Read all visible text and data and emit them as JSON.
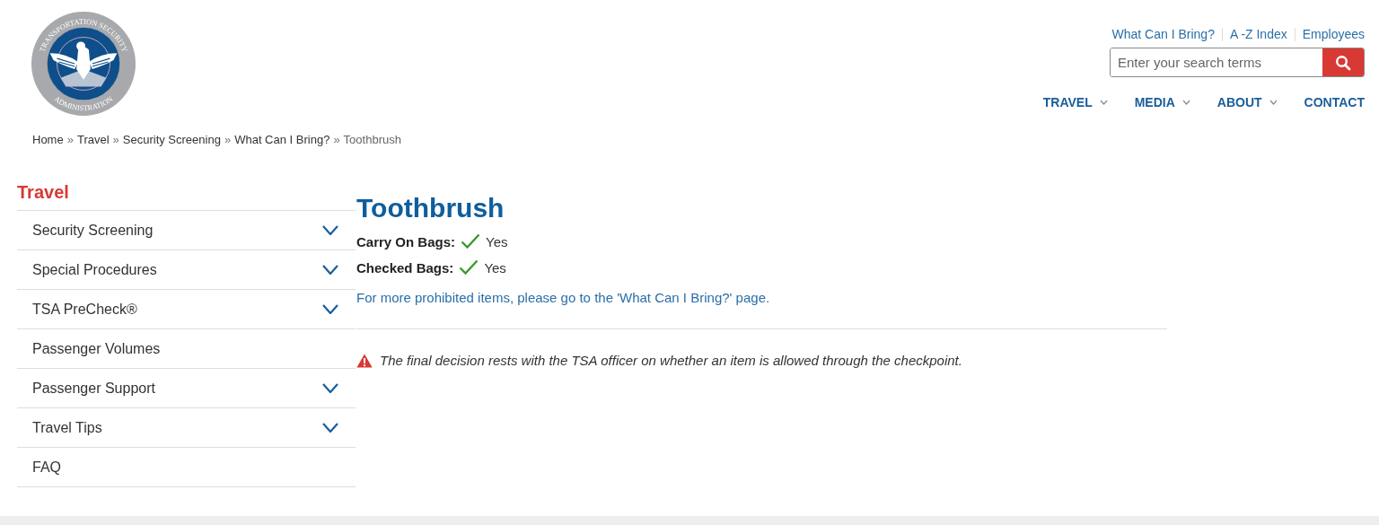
{
  "logo": {
    "top_text": "TRANSPORTATION SECURITY",
    "bottom_text": "ADMINISTRATION"
  },
  "utility_links": [
    "What Can I Bring?",
    "A -Z Index",
    "Employees"
  ],
  "search": {
    "placeholder": "Enter your search terms"
  },
  "nav": [
    {
      "label": "TRAVEL",
      "dropdown": true
    },
    {
      "label": "MEDIA",
      "dropdown": true
    },
    {
      "label": "ABOUT",
      "dropdown": true
    },
    {
      "label": "CONTACT",
      "dropdown": false
    }
  ],
  "breadcrumb_separator": "»",
  "breadcrumb": [
    {
      "label": "Home",
      "current": false
    },
    {
      "label": "Travel",
      "current": false
    },
    {
      "label": "Security Screening",
      "current": false
    },
    {
      "label": "What Can I Bring?",
      "current": false
    },
    {
      "label": "Toothbrush",
      "current": true
    }
  ],
  "sidebar": {
    "title": "Travel",
    "items": [
      {
        "label": "Security Screening",
        "expandable": true
      },
      {
        "label": "Special Procedures",
        "expandable": true
      },
      {
        "label": "TSA PreCheck®",
        "expandable": true
      },
      {
        "label": "Passenger Volumes",
        "expandable": false
      },
      {
        "label": "Passenger Support",
        "expandable": true
      },
      {
        "label": "Travel Tips",
        "expandable": true
      },
      {
        "label": "FAQ",
        "expandable": false
      }
    ]
  },
  "item": {
    "title": "Toothbrush",
    "rules": [
      {
        "label": "Carry On Bags:",
        "allowed": true,
        "value": "Yes"
      },
      {
        "label": "Checked Bags:",
        "allowed": true,
        "value": "Yes"
      }
    ],
    "more_link": "For more prohibited items, please go to the 'What Can I Bring?' page.",
    "notice": "The final decision rests with the TSA officer on whether an item is allowed through the checkpoint."
  }
}
